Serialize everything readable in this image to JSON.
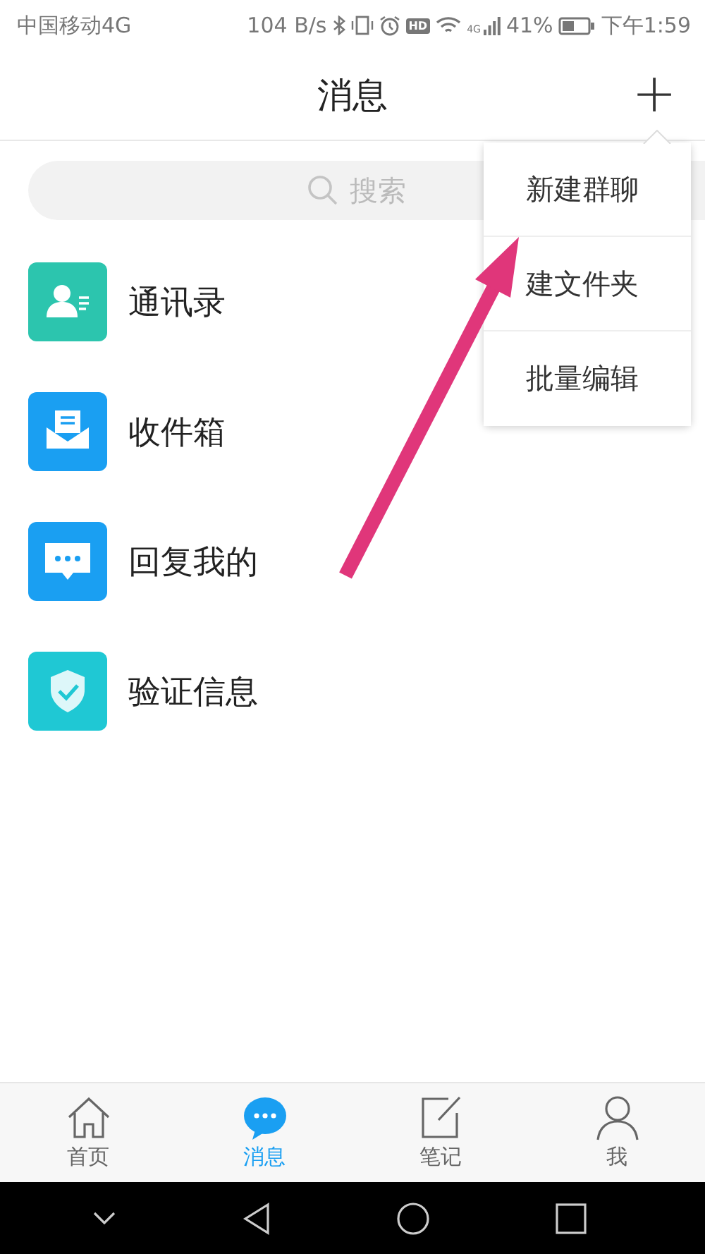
{
  "status_bar": {
    "carrier": "中国移动4G",
    "speed": "104 B/s",
    "hd": "HD",
    "network": "4G",
    "battery": "41%",
    "time": "下午1:59"
  },
  "header": {
    "title": "消息",
    "add": "+"
  },
  "search": {
    "placeholder": "搜索"
  },
  "items": [
    {
      "label": "通讯录",
      "kind": "contacts",
      "color": "#2cc5ae"
    },
    {
      "label": "收件箱",
      "kind": "inbox",
      "color": "#1a9ff2"
    },
    {
      "label": "回复我的",
      "kind": "reply",
      "color": "#1a9ff2"
    },
    {
      "label": "验证信息",
      "kind": "verify",
      "color": "#1fc8d4"
    }
  ],
  "menu": [
    {
      "label": "新建群聊"
    },
    {
      "label": "建文件夹"
    },
    {
      "label": "批量编辑"
    }
  ],
  "tabs": [
    {
      "label": "首页",
      "kind": "home",
      "selected": false
    },
    {
      "label": "消息",
      "kind": "chat",
      "selected": true
    },
    {
      "label": "笔记",
      "kind": "note",
      "selected": false
    },
    {
      "label": "我",
      "kind": "me",
      "selected": false
    }
  ]
}
